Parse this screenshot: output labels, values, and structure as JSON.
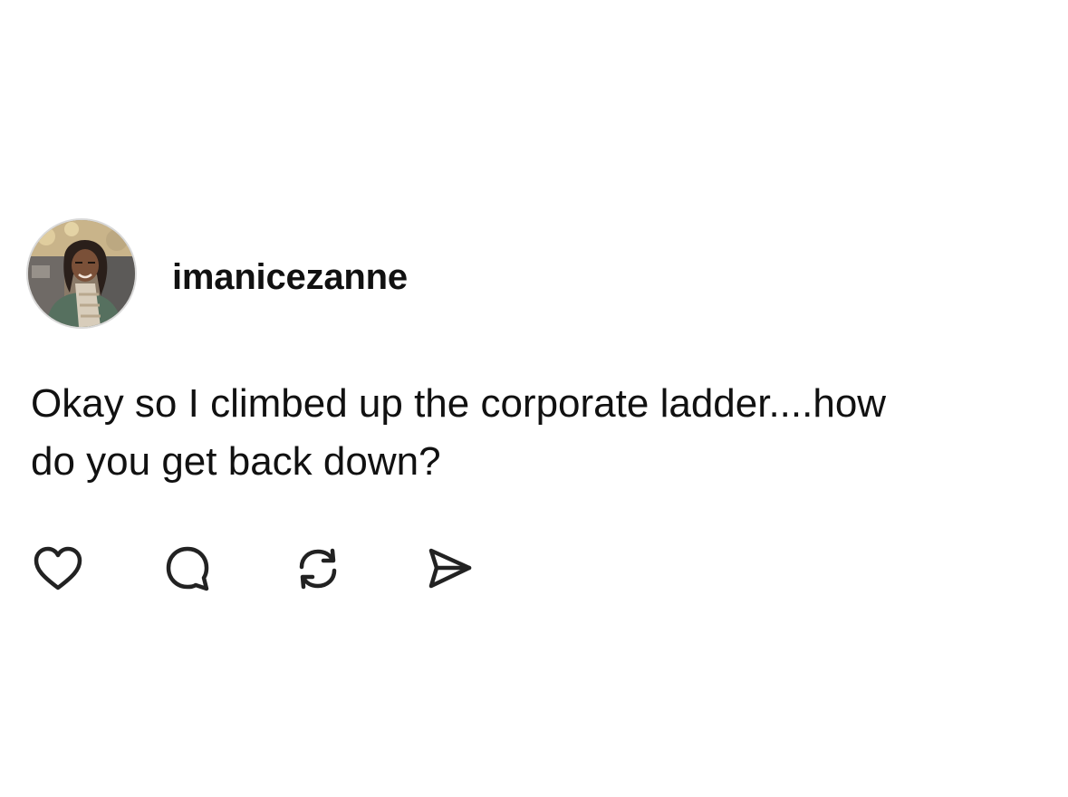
{
  "post": {
    "username": "imanicezanne",
    "text_line1": "Okay so I climbed up the corporate ladder....how",
    "text_line2": "do you get back down?",
    "actions": {
      "like_icon": "heart-icon",
      "comment_icon": "comment-bubble-icon",
      "repost_icon": "repost-arrows-icon",
      "share_icon": "send-paper-plane-icon"
    }
  },
  "colors": {
    "background": "#ffffff",
    "text": "#111111",
    "icon_stroke": "#222222",
    "avatar_border": "#d9d9d9"
  }
}
